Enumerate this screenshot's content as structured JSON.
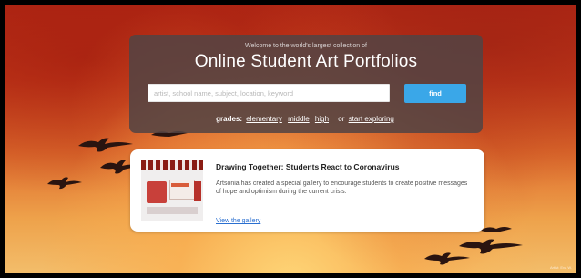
{
  "hero": {
    "tagline": "Welcome to the world's largest collection of",
    "title": "Online Student Art Portfolios",
    "search_placeholder": "artist, school name, subject, location, keyword",
    "find_label": "find",
    "grades_label": "grades:",
    "grades": [
      "elementary",
      "middle",
      "high"
    ],
    "or_text": "or",
    "explore_label": "start exploring"
  },
  "card": {
    "title": "Drawing Together: Students React to Coronavirus",
    "description": "Artsonia has created a special gallery to encourage students to create positive messages of hope and optimism during the current crisis.",
    "link_label": "View the gallery"
  },
  "credit": "Artist: Eva W.",
  "colors": {
    "accent": "#3aa7e8",
    "hero_panel": "#524444",
    "link": "#2a6fd0"
  },
  "icons": [
    "bird-silhouette-icon"
  ]
}
